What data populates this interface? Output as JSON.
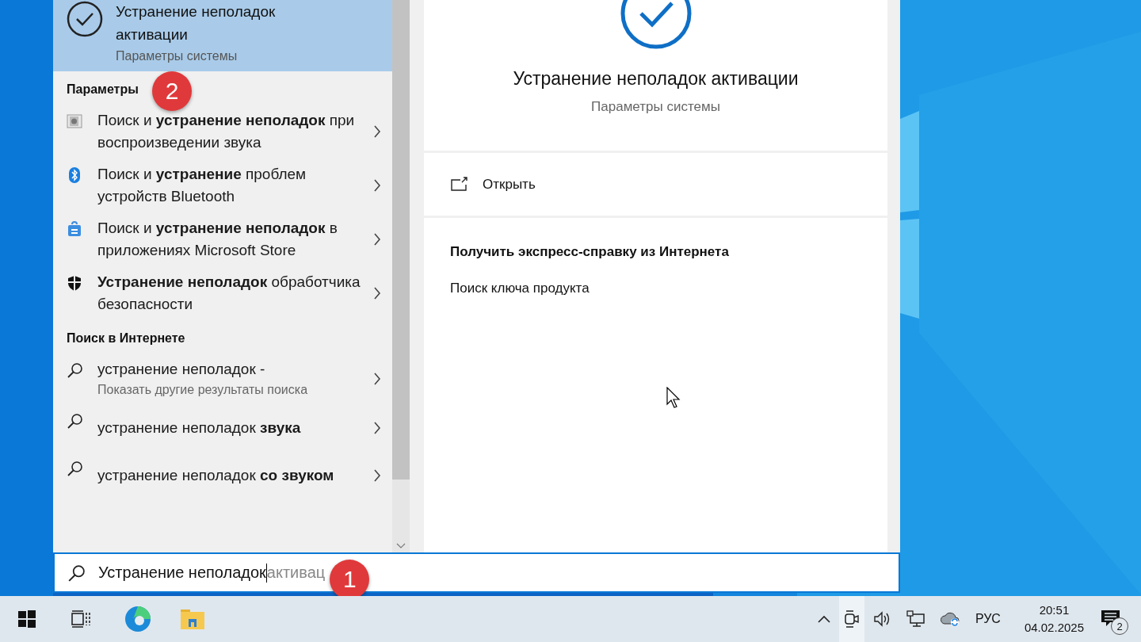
{
  "top_result": {
    "title": "Устранение неполадок активации",
    "subtitle": "Параметры системы",
    "selected": true
  },
  "sections": [
    {
      "heading": "Параметры",
      "badge": "2",
      "items": [
        {
          "kind": "sound",
          "text": "Поиск и **устранение неполадок** при воспроизведении звука",
          "selected": false
        },
        {
          "kind": "bluetooth",
          "text": "Поиск и **устранение** проблем устройств Bluetooth",
          "selected": false
        },
        {
          "kind": "store",
          "text": "Поиск и **устранение неполадок** в приложениях Microsoft Store",
          "selected": false
        },
        {
          "kind": "shield",
          "text": "**Устранение неполадок** обработчика безопасности",
          "selected": false
        }
      ]
    },
    {
      "heading": "Поиск в Интернете",
      "items": [
        {
          "kind": "search",
          "text": "устранение неполадок -",
          "subtitle": "Показать другие результаты поиска",
          "selected": false
        },
        {
          "kind": "search",
          "text": "устранение неполадок **звука**",
          "selected": false
        },
        {
          "kind": "search",
          "text": "устранение неполадок **со звуком**",
          "selected": false
        }
      ]
    }
  ],
  "details": {
    "title": "Устранение неполадок активации",
    "subtitle": "Параметры системы",
    "actions": [
      {
        "label": "Открыть"
      }
    ],
    "help_heading": "Получить экспресс-справку из Интернета",
    "links": [
      "Поиск ключа продукта"
    ]
  },
  "search": {
    "value": "Устранение неполадок",
    "suggestion": "активац",
    "badge": "1"
  },
  "taskbar": {
    "language": "РУС",
    "time": "20:51",
    "date": "04.02.2025",
    "notification_count": "2"
  }
}
